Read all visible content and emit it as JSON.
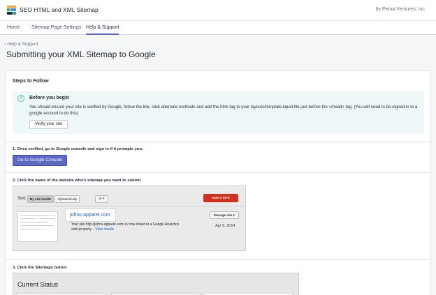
{
  "app": {
    "title": "SEO HTML and XML Sitemap",
    "company": "by Petna Ventures, Inc.",
    "logo_colors": [
      "#ff9f2e",
      "#34a853",
      "#4285f4",
      "#0b2a4a"
    ]
  },
  "nav": {
    "tabs": [
      {
        "label": "Home",
        "active": false
      },
      {
        "label": "Sitemap Page Settings",
        "active": false
      },
      {
        "label": "Help & Support",
        "active": true
      }
    ]
  },
  "breadcrumb": {
    "label": "Help & Support",
    "icon": "chevron-left-icon"
  },
  "page_title": "Submitting your XML Sitemap to Google",
  "card": {
    "title": "Steps to Follow",
    "banner": {
      "icon": "info-icon",
      "heading": "Before you begin",
      "body": "You should ensure your site is verified by Google, follow the link, click alternate methods and add the html tag to your layouts/template.liquid file just before the </head> tag. (You will need to be signed in to a google account to do this)",
      "button": "Verify your site"
    },
    "steps": [
      {
        "label": "1. Once verified, go to Google console and sign in if it prompts you.",
        "button": "Go to Google Console"
      },
      {
        "label": "2. Click the name of the website who's sitemap you want to submit"
      },
      {
        "label": "3. Click the Sitemaps button"
      }
    ]
  },
  "screenshot1": {
    "sort_label": "Sort:",
    "sort_health": "By site health",
    "sort_alpha": "Alphabetically",
    "list_toggle": "☰ ▾",
    "add_site": "ADD A SITE",
    "domain": "johns-apparel.com",
    "manage_site": "Manage site ▾",
    "message": "Your site http://johns-apparel.com/ is now linked to a Google Analytics web property. -",
    "view_details": "View details",
    "date": "Apr 9, 2014"
  },
  "screenshot2": {
    "heading": "Current Status"
  },
  "colors": {
    "primary": "#5c6ac4",
    "banner_bg": "#eef8f9",
    "info_accent": "#47c1bf",
    "add_site_red": "#d2311e"
  }
}
